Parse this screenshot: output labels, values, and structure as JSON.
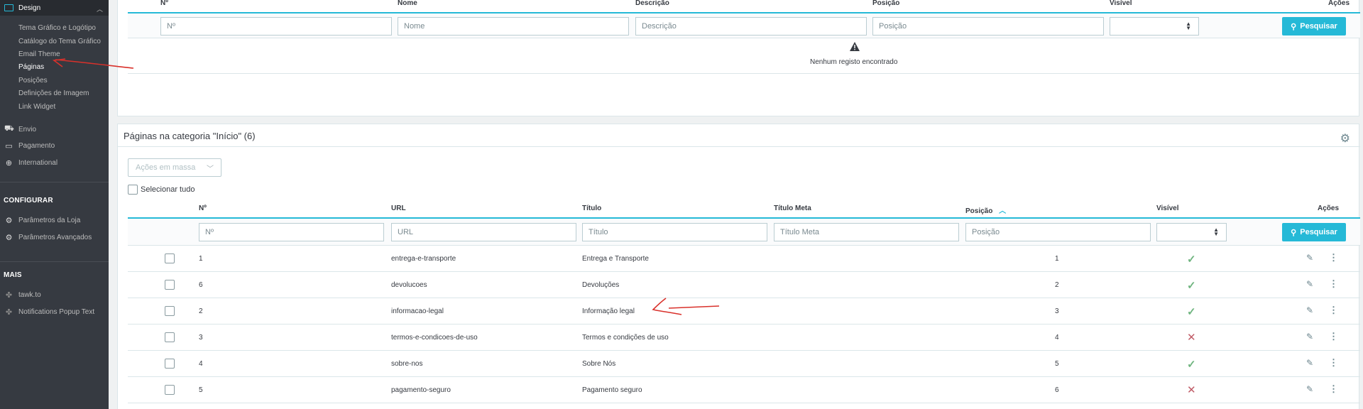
{
  "sidebar": {
    "design_label": "Design",
    "design_items": [
      "Tema Gráfico e Logótipo",
      "Catálogo do Tema Gráfico",
      "Email Theme",
      "Páginas",
      "Posições",
      "Definições de Imagem",
      "Link Widget"
    ],
    "envio": "Envio",
    "pagamento": "Pagamento",
    "international": "International",
    "configurar": "CONFIGURAR",
    "parametros_loja": "Parâmetros da Loja",
    "parametros_avancados": "Parâmetros Avançados",
    "mais": "MAIS",
    "tawk": "tawk.to",
    "notifications": "Notifications Popup Text"
  },
  "categories_table": {
    "headers": {
      "id": "Nº",
      "name": "Nome",
      "description": "Descrição",
      "position": "Posição",
      "visible": "Visível",
      "actions": "Ações"
    },
    "placeholders": {
      "id": "Nº",
      "name": "Nome",
      "description": "Descrição",
      "position": "Posição"
    },
    "search_label": "Pesquisar",
    "empty_message": "Nenhum registo encontrado"
  },
  "pages_panel": {
    "title": "Páginas na categoria \"Início\" (6)",
    "bulk_actions": "Ações em massa",
    "select_all": "Selecionar tudo",
    "headers": {
      "id": "Nº",
      "url": "URL",
      "title": "Título",
      "meta_title": "Título Meta",
      "position": "Posição",
      "visible": "Visível",
      "actions": "Ações"
    },
    "placeholders": {
      "id": "Nº",
      "url": "URL",
      "title": "Título",
      "meta_title": "Título Meta",
      "position": "Posição"
    },
    "search_label": "Pesquisar",
    "rows": [
      {
        "id": "1",
        "url": "entrega-e-transporte",
        "title": "Entrega e Transporte",
        "position": "1",
        "visible": true
      },
      {
        "id": "6",
        "url": "devolucoes",
        "title": "Devoluções",
        "position": "2",
        "visible": true
      },
      {
        "id": "2",
        "url": "informacao-legal",
        "title": "Informação legal",
        "position": "3",
        "visible": true
      },
      {
        "id": "3",
        "url": "termos-e-condicoes-de-uso",
        "title": "Termos e condições de uso",
        "position": "4",
        "visible": false
      },
      {
        "id": "4",
        "url": "sobre-nos",
        "title": "Sobre Nós",
        "position": "5",
        "visible": true
      },
      {
        "id": "5",
        "url": "pagamento-seguro",
        "title": "Pagamento seguro",
        "position": "6",
        "visible": false
      }
    ]
  },
  "colors": {
    "accent": "#25b9d7",
    "sidebar": "#363a41",
    "check": "#70b580",
    "cross": "#c05c67",
    "annotation": "#d9312b"
  }
}
